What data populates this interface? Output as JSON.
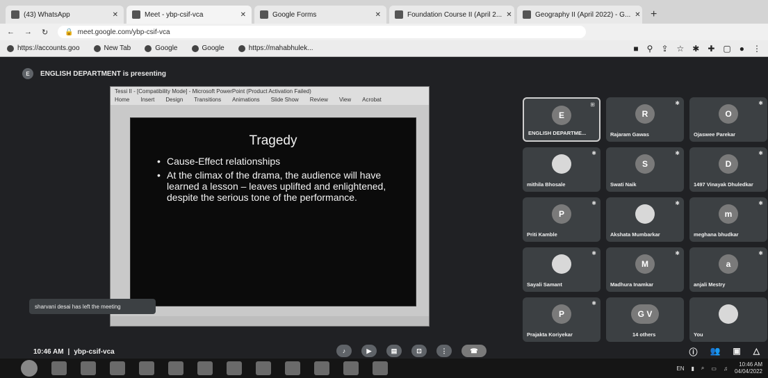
{
  "browser": {
    "tabs": [
      {
        "label": "(43) WhatsApp"
      },
      {
        "label": "Meet - ybp-csif-vca"
      },
      {
        "label": "Google Forms"
      },
      {
        "label": "Foundation Course II (April 2..."
      },
      {
        "label": "Geography II (April 2022) - G..."
      }
    ],
    "new_tab": "+",
    "url": "meet.google.com/ybp-csif-vca",
    "bookmarks": [
      {
        "label": "https://accounts.goo"
      },
      {
        "label": "New Tab"
      },
      {
        "label": "Google"
      },
      {
        "label": "Google"
      },
      {
        "label": "https://mahabhulek..."
      }
    ]
  },
  "meet": {
    "presenting_text": "ENGLISH DEPARTMENT is presenting",
    "meeting_code": "ybp-csif-vca",
    "time": "10:46 AM",
    "separator": "|",
    "toast": "sharvani desai has left the meeting",
    "slide": {
      "ppt_title": "Tessi II - [Compatibility Mode] - Microsoft PowerPoint (Product Activation Failed)",
      "ppt_menu": [
        "Home",
        "Insert",
        "Design",
        "Transitions",
        "Animations",
        "Slide Show",
        "Review",
        "View",
        "Acrobat"
      ],
      "title": "Tragedy",
      "bullets": [
        "Cause-Effect relationships",
        "At the climax of the drama, the audience will have learned a lesson – leaves uplifted and enlightened, despite the serious tone of the performance."
      ]
    },
    "participants": [
      {
        "initial": "E",
        "name": "ENGLISH DEPARTME..."
      },
      {
        "initial": "R",
        "name": "Rajaram Gawas"
      },
      {
        "initial": "O",
        "name": "Ojaswee Parekar"
      },
      {
        "initial": "",
        "name": "mithila Bhosale"
      },
      {
        "initial": "S",
        "name": "Swati Naik"
      },
      {
        "initial": "D",
        "name": "1497 Vinayak Dhuledkar"
      },
      {
        "initial": "P",
        "name": "Priti Kamble"
      },
      {
        "initial": "",
        "name": "Akshata Mumbarkar"
      },
      {
        "initial": "m",
        "name": "meghana bhudkar"
      },
      {
        "initial": "",
        "name": "Sayali Samant"
      },
      {
        "initial": "M",
        "name": "Madhura Inamkar"
      },
      {
        "initial": "a",
        "name": "anjali Mestry"
      },
      {
        "initial": "P",
        "name": "Prajakta Koriyekar"
      },
      {
        "initial": "G V",
        "name": "14 others"
      },
      {
        "initial": "",
        "name": "You"
      }
    ]
  },
  "taskbar": {
    "time": "10:46 AM",
    "date": "04/04/2022",
    "lang": "EN"
  }
}
